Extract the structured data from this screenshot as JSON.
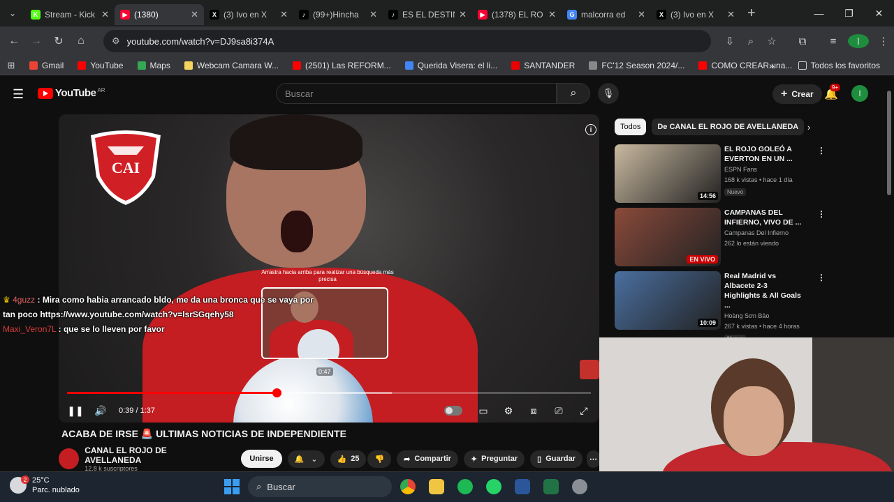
{
  "browser": {
    "tabs": [
      {
        "title": "Stream - Kick",
        "color": "#53fc18",
        "glyph": "K"
      },
      {
        "title": "(1380)",
        "color": "#ff0033",
        "glyph": "▶",
        "active": true
      },
      {
        "title": "(3) Ivo en X",
        "color": "#000000",
        "glyph": "X"
      },
      {
        "title": "(99+)Hincha",
        "color": "#000000",
        "glyph": "♪"
      },
      {
        "title": "ES EL DESTIN",
        "color": "#000000",
        "glyph": "♪"
      },
      {
        "title": "(1378) EL RO",
        "color": "#ff0033",
        "glyph": "▶"
      },
      {
        "title": "malcorra ed",
        "color": "#4285f4",
        "glyph": "G"
      },
      {
        "title": "(3) Ivo en X",
        "color": "#000000",
        "glyph": "X"
      }
    ],
    "url": "youtube.com/watch?v=DJ9sa8i374A",
    "bookmarks": [
      {
        "label": "Gmail",
        "color": "#ea4335"
      },
      {
        "label": "YouTube",
        "color": "#ff0000"
      },
      {
        "label": "Maps",
        "color": "#34a853"
      },
      {
        "label": "Webcam Camara W...",
        "color": "#f4d35e"
      },
      {
        "label": "(2501) Las REFORM...",
        "color": "#ff0000"
      },
      {
        "label": "Querida Visera: el li...",
        "color": "#4285f4"
      },
      {
        "label": "SANTANDER",
        "color": "#ec0000"
      },
      {
        "label": "FC'12 Season 2024/...",
        "color": "#888888"
      },
      {
        "label": "COMO CREAR una...",
        "color": "#ff0000"
      }
    ],
    "all_bookmarks": "Todos los favoritos"
  },
  "youtube": {
    "logo": "YouTube",
    "region": "AR",
    "search_placeholder": "Buscar",
    "create_label": "Crear",
    "notifications": "9+",
    "avatar_letter": "I"
  },
  "player": {
    "drag_hint": "Arrastra hacia arriba para realizar una búsqueda más precisa",
    "preview_time": "0:47",
    "time_display": "0:39 / 1:37",
    "played_fraction": 0.4,
    "buffered_fraction": 0.62
  },
  "chat": [
    {
      "user": "4guzz",
      "text": ": Mira como habia arrancado bldo, me da una bronca que se vaya por tan poco https://www.youtube.com/watch?v=lsrSGqehy58"
    },
    {
      "user": "Maxi_Veron7L",
      "text": ": que se lo lleven por favor"
    }
  ],
  "video": {
    "title": "ACABA DE IRSE 🚨 ULTIMAS NOTICIAS DE INDEPENDIENTE",
    "channel": "CANAL EL ROJO DE AVELLANEDA",
    "subscribers": "12.8 k suscriptores",
    "subscribe_label": "Unirse",
    "likes": "25",
    "share_label": "Compartir",
    "ask_label": "Preguntar",
    "save_label": "Guardar"
  },
  "sidebar": {
    "chips": [
      "Todos",
      "De CANAL EL ROJO DE AVELLANEDA"
    ],
    "recommendations": [
      {
        "title": "EL ROJO GOLEÓ A EVERTON EN UN ...",
        "channel": "ESPN Fans",
        "meta": "168 k vistas • hace 1 día",
        "badge": "Nuevo",
        "duration": "14:56",
        "thumb_color": "#c9b9a0"
      },
      {
        "title": "CAMPANAS DEL INFIERNO, VIVO DE ...",
        "channel": "Campanas Del Infierno",
        "meta": "262 lo están viendo",
        "badge": "",
        "duration": "EN VIVO",
        "thumb_color": "#8a4a3a"
      },
      {
        "title": "Real Madrid vs Albacete 2-3 Highlights & All Goals ...",
        "channel": "Hoàng Sơn Bảo",
        "meta": "267 k vistas • hace 4 horas",
        "badge": "Nuevo",
        "duration": "10:09",
        "thumb_color": "#4a6fa0"
      }
    ]
  },
  "taskbar": {
    "temperature": "25°C",
    "condition": "Parc. nublado",
    "search_label": "Buscar",
    "weather_badge": "2"
  }
}
